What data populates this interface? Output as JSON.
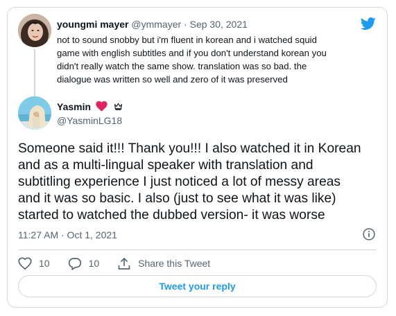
{
  "reply_to": {
    "name": "youngmi mayer",
    "handle": "@ymmayer",
    "separator": "·",
    "date": "Sep 30, 2021",
    "text_lines": [
      "not to sound snobby but i'm fluent in korean and i watched squid",
      "game with english subtitles and if you don't understand korean you",
      "didn't really watch the same show. translation was so bad. the",
      "dialogue was written so well and zero of it was preserved"
    ]
  },
  "tweet": {
    "name": "Yasmin",
    "emoji_heart": "❤️",
    "handle": "@YasminLG18",
    "text_lines": [
      "Someone said it!!! Thank you!!! I also watched it in Korean",
      "and as a multi-lingual speaker with translation and",
      "subtitling experience I just noticed a lot of messy areas",
      "and it was so basic. I also (just to see what it was like)",
      "started to watched the dubbed version- it was worse"
    ],
    "timestamp": "11:27 AM · Oct 1, 2021"
  },
  "actions": {
    "likes": "10",
    "replies": "10",
    "share_label": "Share this Tweet"
  },
  "reply_button_label": "Tweet your reply",
  "colors": {
    "accent": "#1d9bf0",
    "heart": "#e0245e",
    "muted": "#536471",
    "border": "#cfd9de"
  },
  "icons": [
    "twitter-bird-icon",
    "heart-icon",
    "crown-icon",
    "info-icon",
    "like-icon",
    "reply-icon",
    "share-icon"
  ]
}
